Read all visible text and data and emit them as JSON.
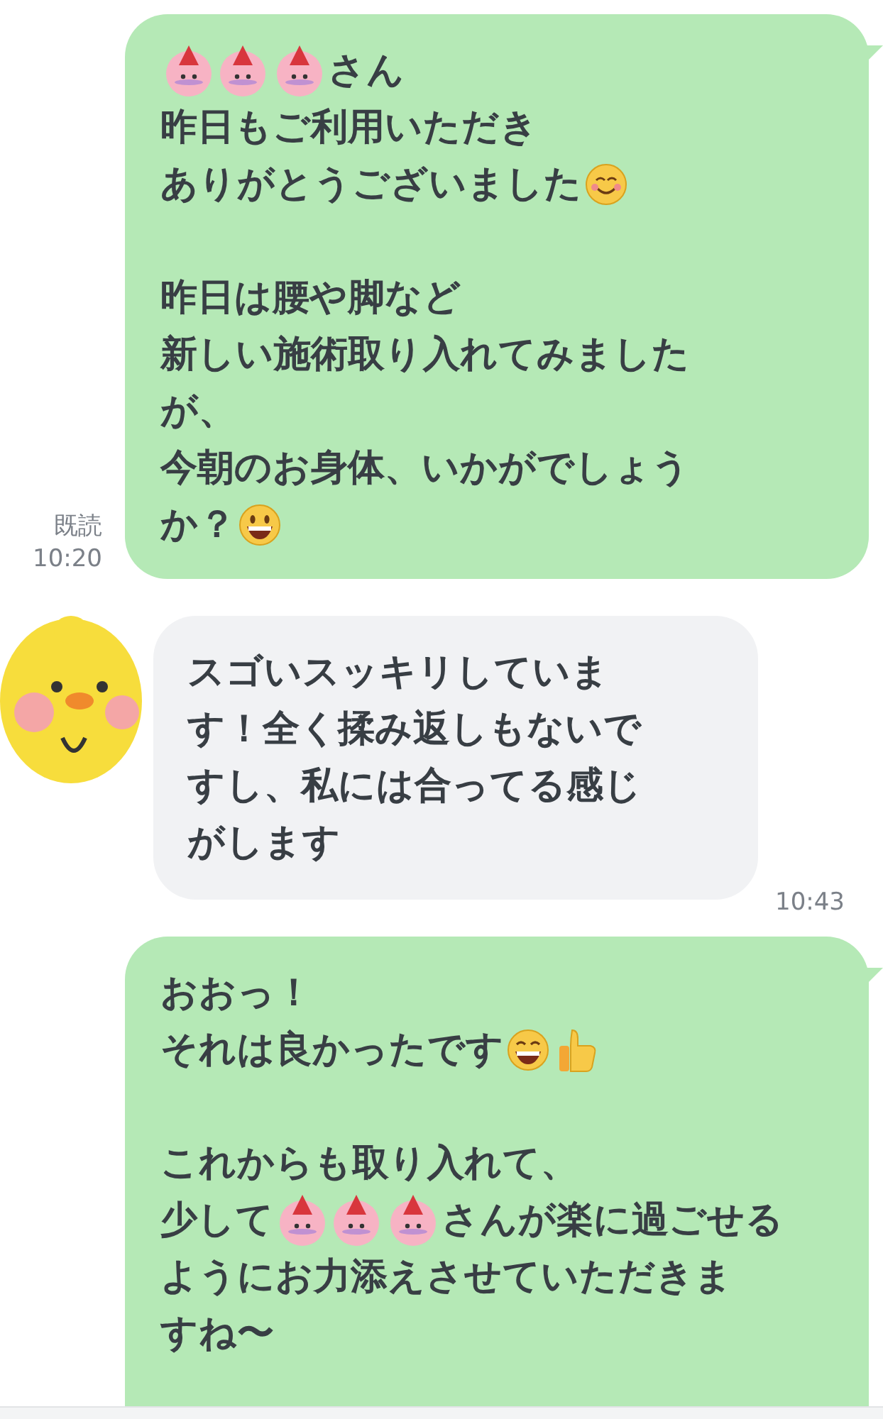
{
  "messages": [
    {
      "kind": "sent",
      "read": "既読",
      "time": "10:20",
      "paragraphs": [
        [
          [
            {
              "kind": "cats"
            },
            {
              "kind": "text",
              "text": "さん"
            }
          ],
          [
            {
              "kind": "text",
              "text": "昨日もご利用いただき"
            }
          ],
          [
            {
              "kind": "text",
              "text": "ありがとうございました"
            },
            {
              "kind": "smile"
            }
          ]
        ],
        [
          [
            {
              "kind": "text",
              "text": "昨日は腰や脚など"
            }
          ],
          [
            {
              "kind": "text",
              "text": "新しい施術取り入れてみました"
            }
          ],
          [
            {
              "kind": "text",
              "text": "が、"
            }
          ],
          [
            {
              "kind": "text",
              "text": "今朝のお身体、いかがでしょう"
            }
          ],
          [
            {
              "kind": "text",
              "text": "か？"
            },
            {
              "kind": "grin"
            }
          ]
        ]
      ]
    },
    {
      "kind": "received",
      "time": "10:43",
      "paragraphs": [
        [
          [
            {
              "kind": "text",
              "text": "スゴいスッキリしていま"
            }
          ],
          [
            {
              "kind": "text",
              "text": "す！全く揉み返しもないで"
            }
          ],
          [
            {
              "kind": "text",
              "text": "すし、私には合ってる感じ"
            }
          ],
          [
            {
              "kind": "text",
              "text": "がします"
            }
          ]
        ]
      ]
    },
    {
      "kind": "sent",
      "paragraphs": [
        [
          [
            {
              "kind": "text",
              "text": "おおっ！"
            }
          ],
          [
            {
              "kind": "text",
              "text": "それは良かったです"
            },
            {
              "kind": "beam"
            },
            {
              "kind": "thumbs"
            }
          ]
        ],
        [
          [
            {
              "kind": "text",
              "text": "これからも取り入れて、"
            }
          ],
          [
            {
              "kind": "text",
              "text": "少して"
            },
            {
              "kind": "cats"
            },
            {
              "kind": "text",
              "text": "さんが楽に過ごせる"
            }
          ],
          [
            {
              "kind": "text",
              "text": "ようにお力添えさせていただきま"
            }
          ],
          [
            {
              "kind": "text",
              "text": "すね〜"
            }
          ]
        ]
      ]
    }
  ]
}
